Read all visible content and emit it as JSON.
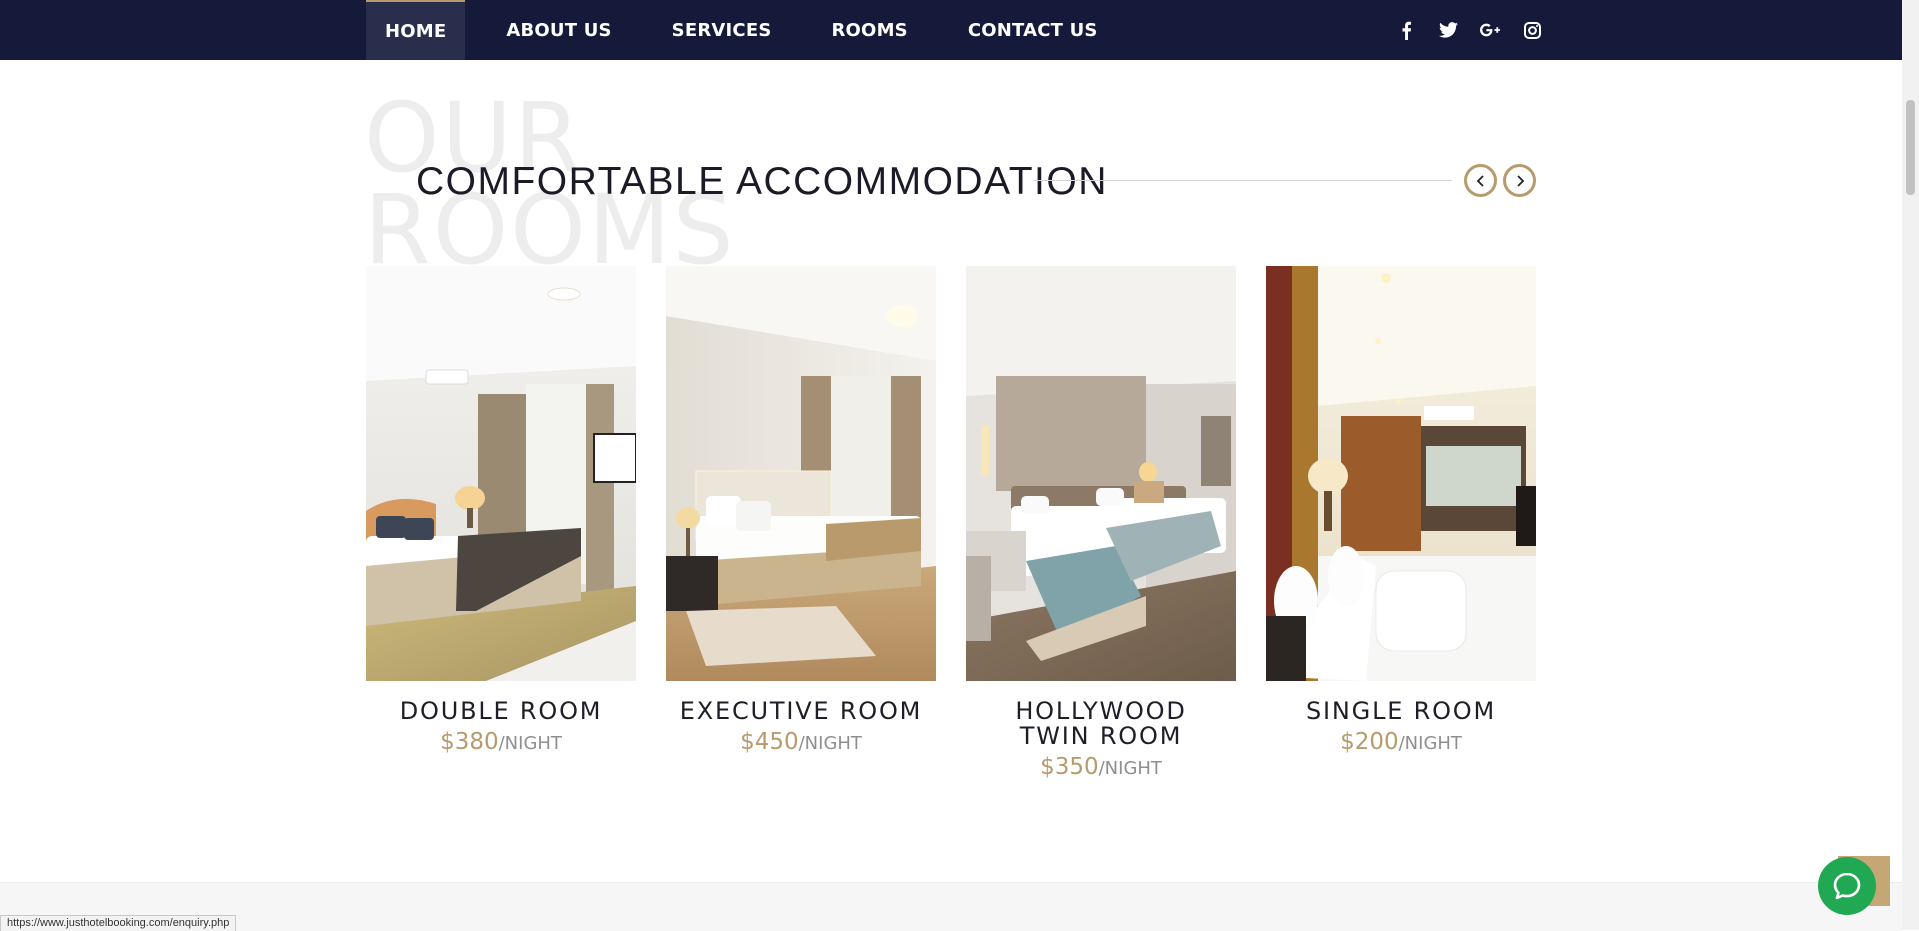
{
  "nav": {
    "items": [
      {
        "label": "HOME",
        "active": true
      },
      {
        "label": "ABOUT US",
        "active": false
      },
      {
        "label": "SERVICES",
        "active": false
      },
      {
        "label": "ROOMS",
        "active": false
      },
      {
        "label": "CONTACT US",
        "active": false
      }
    ],
    "social": [
      "facebook-icon",
      "twitter-icon",
      "google-plus-icon",
      "instagram-icon"
    ]
  },
  "section": {
    "background_title": "OUR\nROOMS",
    "title": "COMFORTABLE ACCOMMODATION"
  },
  "rooms": [
    {
      "name": "DOUBLE ROOM",
      "price": "$380",
      "unit": "/NIGHT"
    },
    {
      "name": "EXECUTIVE ROOM",
      "price": "$450",
      "unit": "/NIGHT"
    },
    {
      "name": "HOLLYWOOD TWIN ROOM",
      "price": "$350",
      "unit": "/NIGHT"
    },
    {
      "name": "SINGLE ROOM",
      "price": "$200",
      "unit": "/NIGHT"
    }
  ],
  "status_bar": {
    "url": "https://www.justhotelbooking.com/enquiry.php"
  },
  "colors": {
    "nav_bg": "#161a3a",
    "accent": "#b79b6c",
    "chat": "#21a852"
  }
}
